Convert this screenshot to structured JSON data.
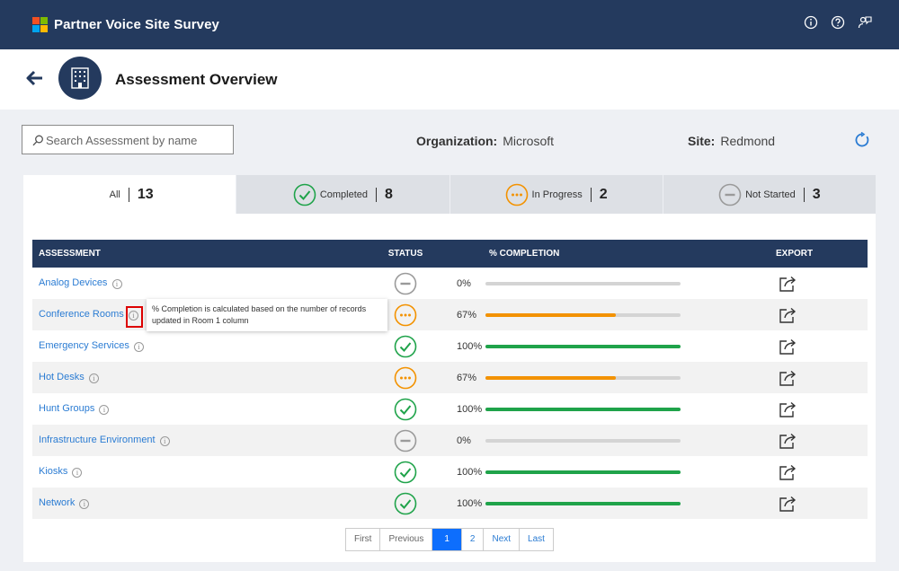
{
  "app": {
    "title": "Partner Voice Site Survey"
  },
  "topbar_icons": [
    "info-icon",
    "help-icon",
    "feedback-icon"
  ],
  "header": {
    "title": "Assessment Overview"
  },
  "search": {
    "placeholder": "Search Assessment by name"
  },
  "organization": {
    "label": "Organization:",
    "value": "Microsoft"
  },
  "site": {
    "label": "Site:",
    "value": "Redmond"
  },
  "tabs": [
    {
      "label": "All",
      "count": "13",
      "icon": ""
    },
    {
      "label": "Completed",
      "count": "8",
      "icon": "check-circle-icon"
    },
    {
      "label": "In Progress",
      "count": "2",
      "icon": "ellipsis-circle-icon"
    },
    {
      "label": "Not Started",
      "count": "3",
      "icon": "minus-circle-icon"
    }
  ],
  "table": {
    "headers": {
      "assessment": "ASSESSMENT",
      "status": "STATUS",
      "completion": "% COMPLETION",
      "export": "EXPORT"
    },
    "rows": [
      {
        "name": "Analog Devices",
        "status": "not-started",
        "percent": "0%",
        "progress": 0
      },
      {
        "name": "Conference Rooms",
        "status": "in-progress",
        "percent": "67%",
        "progress": 0.67
      },
      {
        "name": "Emergency Services",
        "status": "completed",
        "percent": "100%",
        "progress": 1
      },
      {
        "name": "Hot Desks",
        "status": "in-progress",
        "percent": "67%",
        "progress": 0.67
      },
      {
        "name": "Hunt Groups",
        "status": "completed",
        "percent": "100%",
        "progress": 1
      },
      {
        "name": "Infrastructure Environment",
        "status": "not-started",
        "percent": "0%",
        "progress": 0
      },
      {
        "name": "Kiosks",
        "status": "completed",
        "percent": "100%",
        "progress": 1
      },
      {
        "name": "Network",
        "status": "completed",
        "percent": "100%",
        "progress": 1
      }
    ]
  },
  "tooltip": {
    "text": "% Completion is calculated based on the number of records updated in Room 1 column"
  },
  "pager": {
    "first": "First",
    "previous": "Previous",
    "page1": "1",
    "page2": "2",
    "next": "Next",
    "last": "Last"
  },
  "colors": {
    "navy": "#243a5e",
    "green": "#1fa34a",
    "orange": "#f39200",
    "grey": "#9a9a9a",
    "link": "#2b7cd3",
    "active_page": "#0d6efd"
  }
}
